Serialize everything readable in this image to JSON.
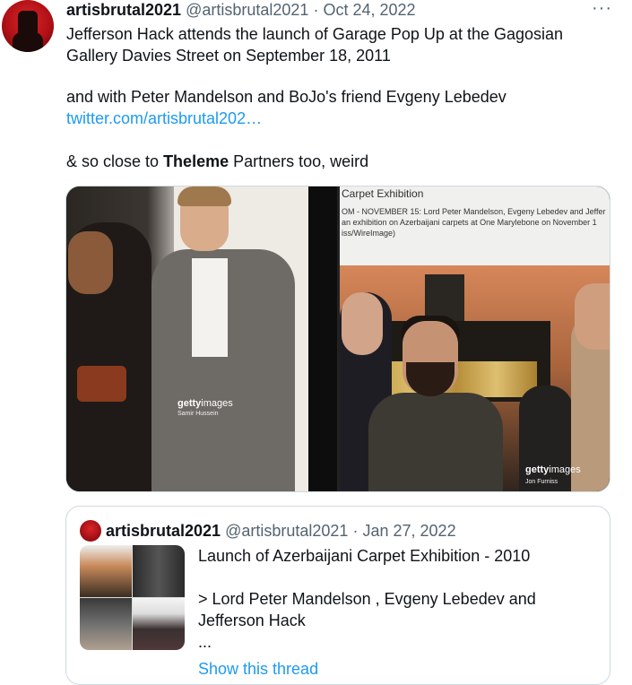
{
  "tweet": {
    "display_name": "artisbrutal2021",
    "handle": "@artisbrutal2021",
    "separator": "·",
    "date": "Oct 24, 2022",
    "more_icon": "more-horizontal-icon",
    "more_glyph": "···",
    "line1": "Jefferson Hack attends the launch of Garage Pop Up at the Gagosian",
    "line2": "Gallery Davies Street on September 18, 2011",
    "line3": "and with Peter Mandelson and BoJo's friend Evgeny Lebedev",
    "link": "twitter.com/artisbrutal202…",
    "line4_pre": "& so close to ",
    "line4_bold": "Theleme",
    "line4_post": " Partners too, weird"
  },
  "media": {
    "left": {
      "getty_bold": "getty",
      "getty_thin": "images",
      "credit": "Samir Hussein"
    },
    "right": {
      "banner_title": "Carpet Exhibition",
      "caption_line1": "OM - NOVEMBER 15: Lord Peter Mandelson, Evgeny Lebedev and Jeffer",
      "caption_line2": "an exhibition on Azerbaijani carpets at One Marylebone on November 1",
      "caption_line3": "iss/WireImage)",
      "getty_bold": "getty",
      "getty_thin": "images",
      "credit": "Jon Furniss"
    }
  },
  "quoted": {
    "display_name": "artisbrutal2021",
    "handle": "@artisbrutal2021",
    "separator": "·",
    "date": "Jan 27, 2022",
    "title": "Launch of Azerbaijani Carpet Exhibition - 2010",
    "line2": "> Lord Peter Mandelson , Evgeny Lebedev and",
    "line3": "Jefferson Hack",
    "ellipsis": "...",
    "show_thread": "Show this thread"
  }
}
